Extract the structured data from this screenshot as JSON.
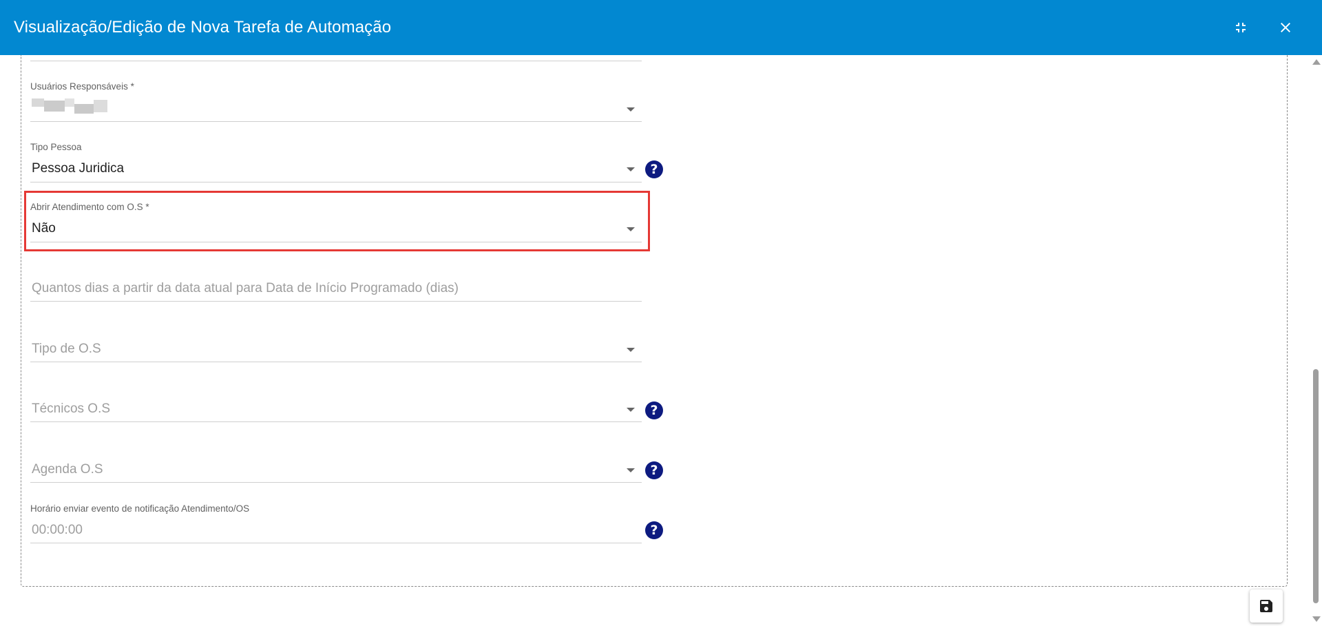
{
  "window": {
    "title": "Visualização/Edição de Nova Tarefa de Automação",
    "minimize_icon": "fullscreen-exit-icon",
    "close_icon": "close-icon"
  },
  "form": {
    "usuarios_responsaveis": {
      "label": "Usuários Responsáveis *",
      "value": ""
    },
    "tipo_pessoa": {
      "label": "Tipo Pessoa",
      "value": "Pessoa Juridica"
    },
    "abrir_atendimento_os": {
      "label": "Abrir Atendimento com O.S *",
      "value": "Não"
    },
    "dias_inicio_programado": {
      "placeholder": "Quantos dias a partir da data atual para Data de Início Programado (dias)"
    },
    "tipo_os": {
      "placeholder": "Tipo de O.S"
    },
    "tecnicos_os": {
      "placeholder": "Técnicos O.S"
    },
    "agenda_os": {
      "placeholder": "Agenda O.S"
    },
    "horario_notificacao": {
      "label": "Horário enviar evento de notificação Atendimento/OS",
      "value": "00:00:00"
    }
  },
  "help_icon_text": "?",
  "colors": {
    "header": "#0288d1",
    "help": "#0d1a80",
    "highlight": "#e53935"
  },
  "save_icon": "save-icon"
}
